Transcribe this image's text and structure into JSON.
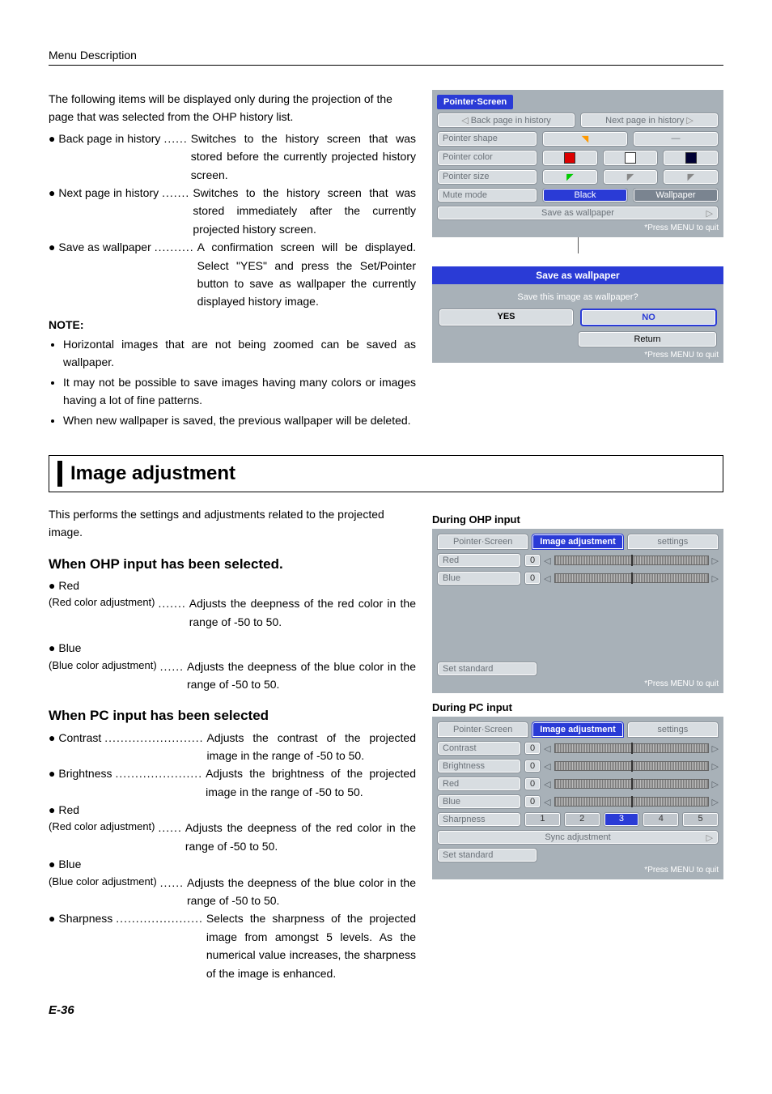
{
  "header": "Menu Description",
  "intro": "The following items will be displayed only during the projection of the page that was selected from the OHP history list.",
  "defs": [
    {
      "term": "Back page in history",
      "dots": "......",
      "desc": "Switches to the history screen that was stored before the currently projected history screen."
    },
    {
      "term": "Next page in history",
      "dots": ".......",
      "desc": "Switches to the history screen that was stored immediately after the currently projected history screen."
    },
    {
      "term": "Save as wallpaper",
      "dots": "..........",
      "desc": "A confirmation screen will be displayed. Select \"YES\" and press the Set/Pointer button to save as wallpaper the currently displayed history image."
    }
  ],
  "note_head": "NOTE:",
  "notes": [
    "Horizontal images that are not being zoomed can be saved as wallpaper.",
    "It may not be possible to save images having many colors or images having a lot of fine patterns.",
    "When new wallpaper is saved, the previous wallpaper will be deleted."
  ],
  "fig1": {
    "title": "Pointer·Screen",
    "back": "Back page in history",
    "next": "Next page in history",
    "shape": "Pointer shape",
    "color": "Pointer color",
    "size": "Pointer size",
    "mute": "Mute mode",
    "mute_black": "Black",
    "mute_wall": "Wallpaper",
    "save": "Save as wallpaper",
    "footer": "*Press MENU to quit"
  },
  "dialog": {
    "title": "Save as wallpaper",
    "question": "Save this image as wallpaper?",
    "yes": "YES",
    "no": "NO",
    "ret": "Return",
    "footer": "*Press MENU to quit"
  },
  "section_title": "Image adjustment",
  "section_intro": "This performs the settings and adjustments related to the projected image.",
  "ohp_head": "When OHP input has been selected.",
  "ohp_items": [
    {
      "name": "Red",
      "sub": "(Red color adjustment)",
      "dots": ".......",
      "desc": "Adjusts the deepness of the red color in the range of -50 to 50."
    },
    {
      "name": "Blue",
      "sub": "(Blue color adjustment)",
      "dots": "......",
      "desc": "Adjusts the deepness of the blue color in the range of -50 to 50."
    }
  ],
  "pc_head": "When PC input has been selected",
  "pc_items": [
    {
      "name": "Contrast",
      "dots": ".........................",
      "desc": "Adjusts the contrast of the projected image in the range of -50 to 50."
    },
    {
      "name": "Brightness",
      "dots": "......................",
      "desc": "Adjusts the brightness of the projected image in the range of -50 to 50."
    },
    {
      "name": "Red",
      "sub": "(Red color adjustment)",
      "dots": "......",
      "desc": "Adjusts the deepness of the red color in the range of -50 to 50."
    },
    {
      "name": "Blue",
      "sub": "(Blue color adjustment)",
      "dots": "......",
      "desc": "Adjusts the deepness of the blue color in the range of -50 to 50."
    },
    {
      "name": "Sharpness",
      "dots": "......................",
      "desc": "Selects the sharpness of the projected image from amongst 5 levels. As the numerical value increases, the sharpness of the image is enhanced."
    }
  ],
  "fig2_head": "During OHP input",
  "fig2": {
    "tab1": "Pointer·Screen",
    "tab2": "Image adjustment",
    "tab3": "settings",
    "red": "Red",
    "blue": "Blue",
    "val": "0",
    "std": "Set standard",
    "footer": "*Press MENU to quit"
  },
  "fig3_head": "During PC input",
  "fig3": {
    "tab1": "Pointer·Screen",
    "tab2": "Image adjustment",
    "tab3": "settings",
    "contrast": "Contrast",
    "brightness": "Brightness",
    "red": "Red",
    "blue": "Blue",
    "sharp": "Sharpness",
    "sharp_vals": [
      "1",
      "2",
      "3",
      "4",
      "5"
    ],
    "sync": "Sync adjustment",
    "std": "Set standard",
    "val": "0",
    "footer": "*Press MENU to quit"
  },
  "page_num": "E-36"
}
